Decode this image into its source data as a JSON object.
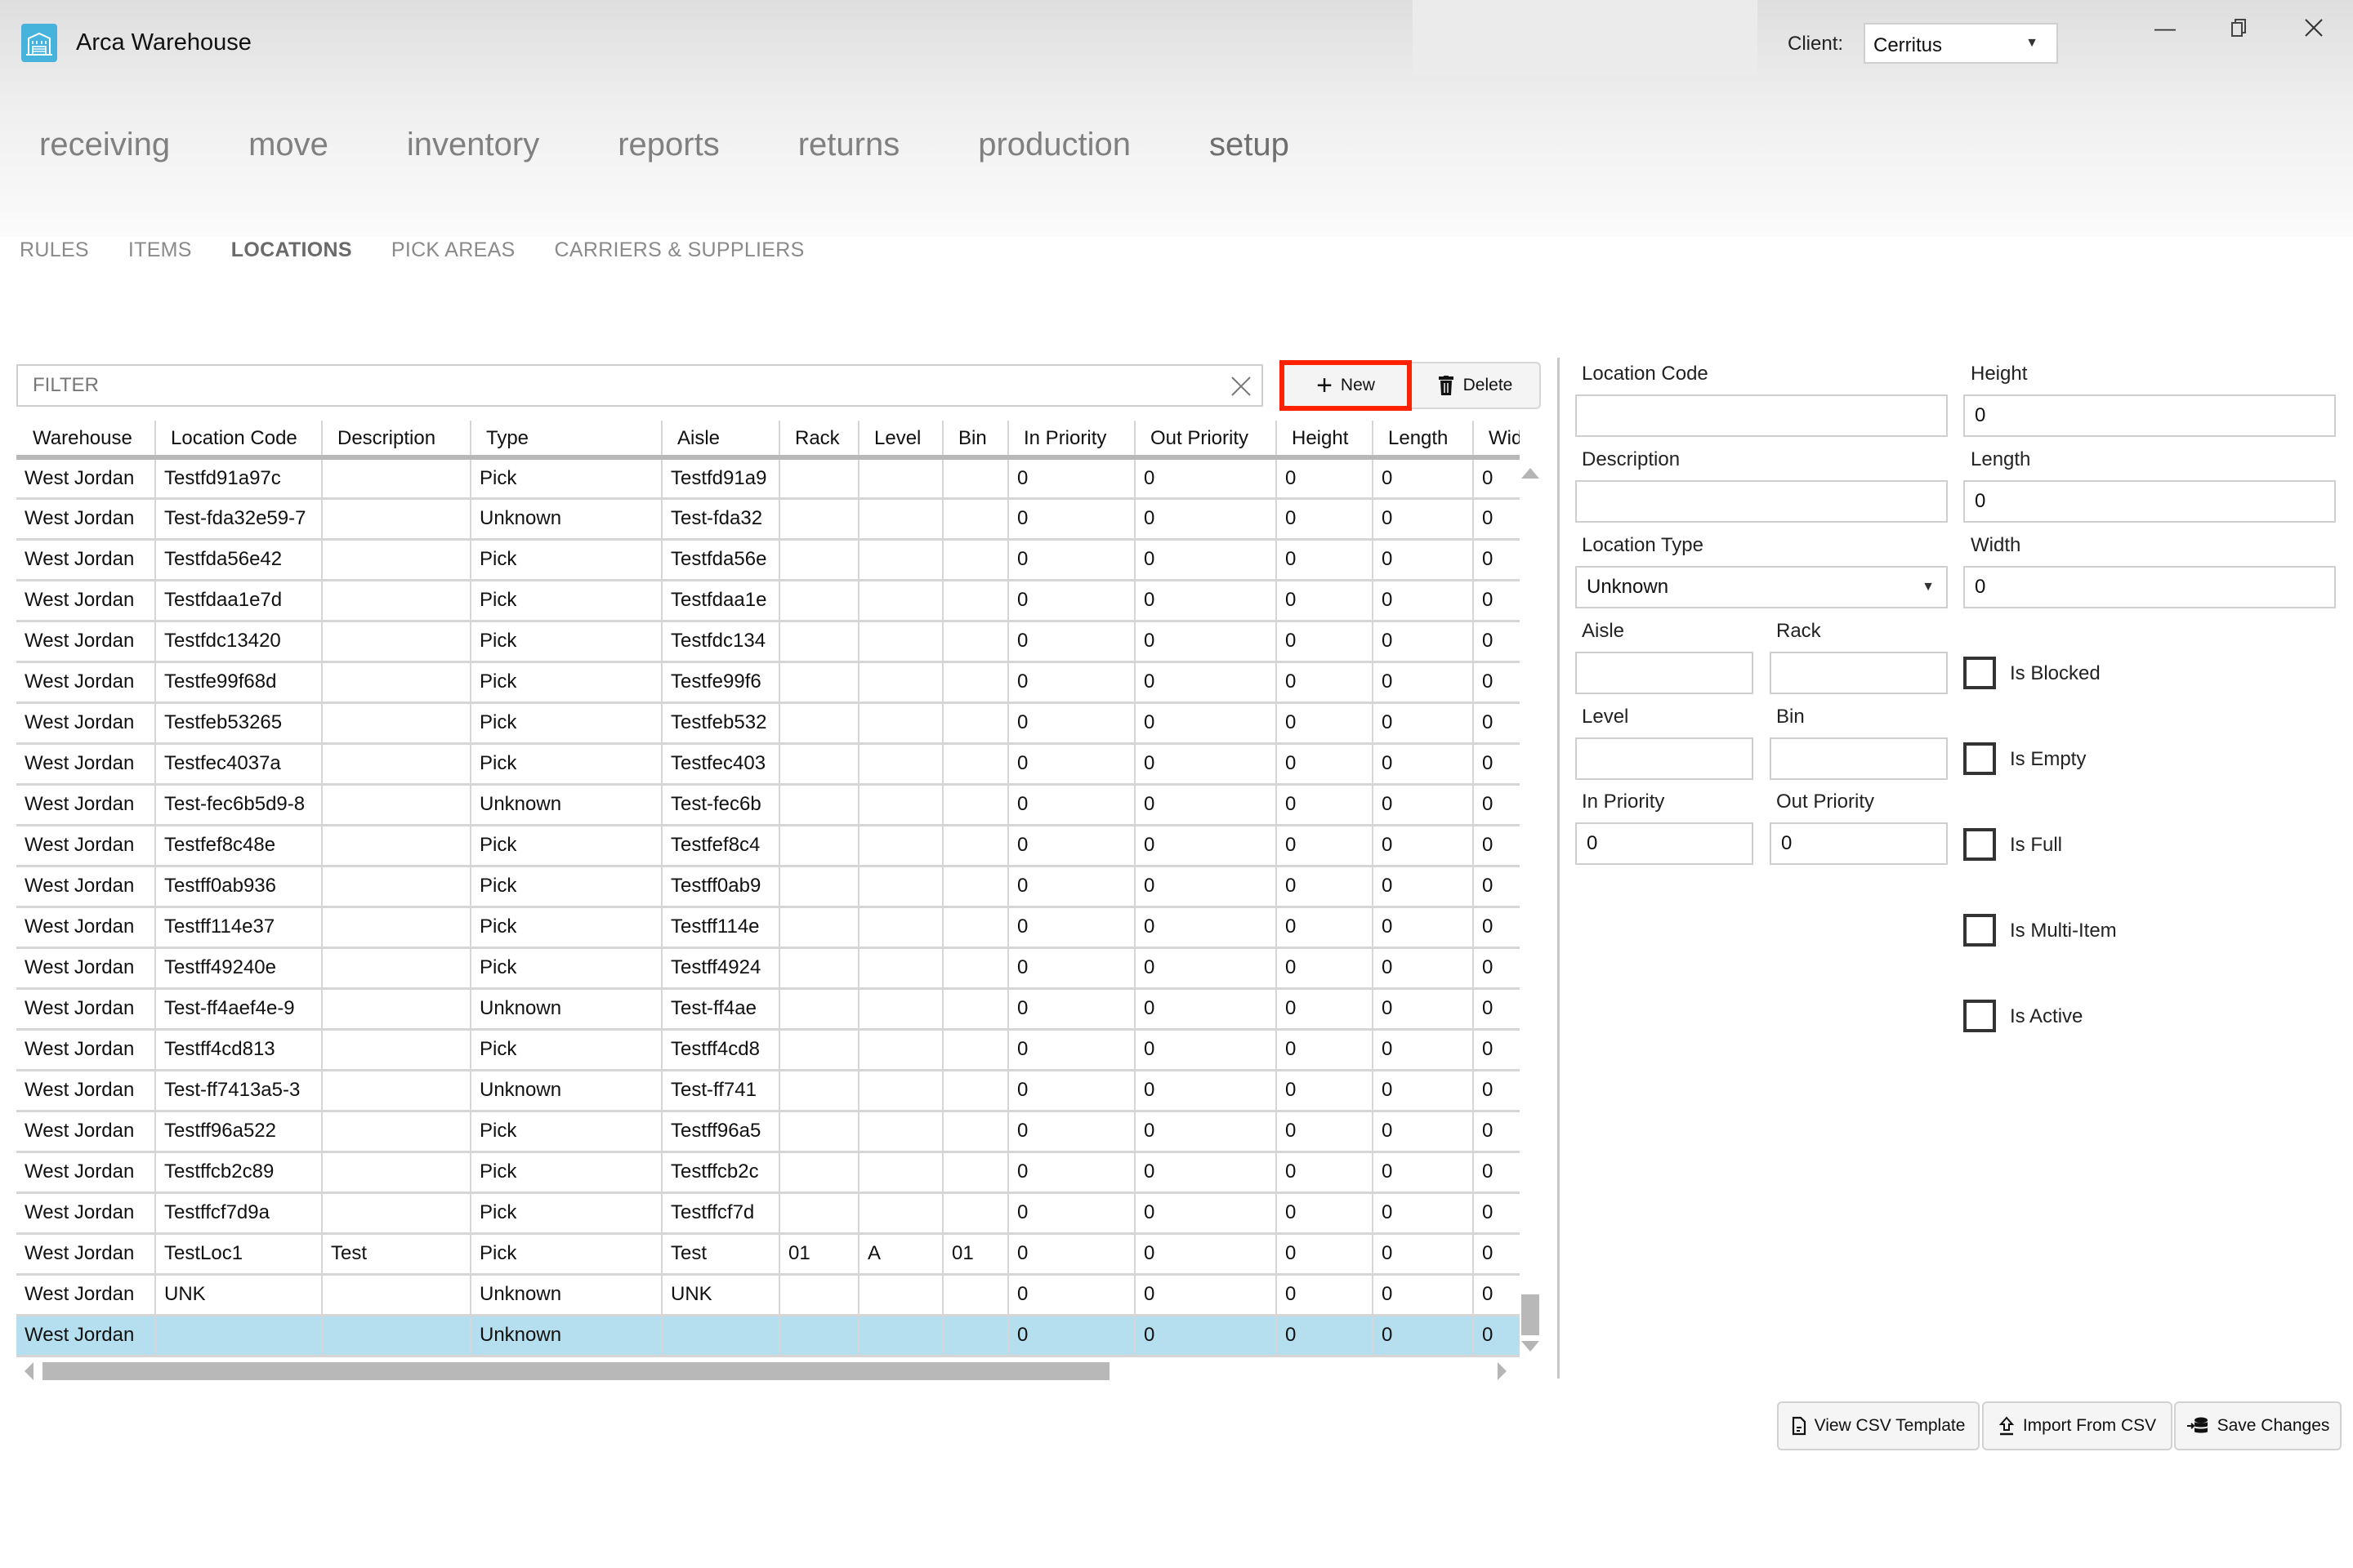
{
  "app": {
    "title": "Arca Warehouse",
    "client_label": "Client:",
    "client_value": "Cerritus",
    "window_controls": {
      "minimize": "minimize-icon",
      "restore": "restore-icon",
      "close": "close-icon"
    }
  },
  "main_nav": [
    {
      "label": "receiving",
      "active": false
    },
    {
      "label": "move",
      "active": false
    },
    {
      "label": "inventory",
      "active": false
    },
    {
      "label": "reports",
      "active": false
    },
    {
      "label": "returns",
      "active": false
    },
    {
      "label": "production",
      "active": false
    },
    {
      "label": "setup",
      "active": true
    }
  ],
  "sub_nav": [
    {
      "label": "RULES",
      "active": false
    },
    {
      "label": "ITEMS",
      "active": false
    },
    {
      "label": "LOCATIONS",
      "active": true
    },
    {
      "label": "PICK AREAS",
      "active": false
    },
    {
      "label": "CARRIERS & SUPPLIERS",
      "active": false
    }
  ],
  "toolbar": {
    "filter_placeholder": "FILTER",
    "filter_value": "",
    "new_label": "New",
    "delete_label": "Delete",
    "highlight_color": "#ff2200"
  },
  "grid": {
    "columns": [
      "Warehouse",
      "Location Code",
      "Description",
      "Type",
      "Aisle",
      "Rack",
      "Level",
      "Bin",
      "In Priority",
      "Out Priority",
      "Height",
      "Length",
      "Wid"
    ],
    "selected_row_color": "#b5dfee",
    "rows": [
      [
        "West Jordan",
        "Testfd91a97c",
        "",
        "Pick",
        "Testfd91a9",
        "",
        "",
        "",
        "0",
        "0",
        "0",
        "0",
        "0"
      ],
      [
        "West Jordan",
        "Test-fda32e59-7",
        "",
        "Unknown",
        "Test-fda32",
        "",
        "",
        "",
        "0",
        "0",
        "0",
        "0",
        "0"
      ],
      [
        "West Jordan",
        "Testfda56e42",
        "",
        "Pick",
        "Testfda56e",
        "",
        "",
        "",
        "0",
        "0",
        "0",
        "0",
        "0"
      ],
      [
        "West Jordan",
        "Testfdaa1e7d",
        "",
        "Pick",
        "Testfdaa1e",
        "",
        "",
        "",
        "0",
        "0",
        "0",
        "0",
        "0"
      ],
      [
        "West Jordan",
        "Testfdc13420",
        "",
        "Pick",
        "Testfdc134",
        "",
        "",
        "",
        "0",
        "0",
        "0",
        "0",
        "0"
      ],
      [
        "West Jordan",
        "Testfe99f68d",
        "",
        "Pick",
        "Testfe99f6",
        "",
        "",
        "",
        "0",
        "0",
        "0",
        "0",
        "0"
      ],
      [
        "West Jordan",
        "Testfeb53265",
        "",
        "Pick",
        "Testfeb532",
        "",
        "",
        "",
        "0",
        "0",
        "0",
        "0",
        "0"
      ],
      [
        "West Jordan",
        "Testfec4037a",
        "",
        "Pick",
        "Testfec403",
        "",
        "",
        "",
        "0",
        "0",
        "0",
        "0",
        "0"
      ],
      [
        "West Jordan",
        "Test-fec6b5d9-8",
        "",
        "Unknown",
        "Test-fec6b",
        "",
        "",
        "",
        "0",
        "0",
        "0",
        "0",
        "0"
      ],
      [
        "West Jordan",
        "Testfef8c48e",
        "",
        "Pick",
        "Testfef8c4",
        "",
        "",
        "",
        "0",
        "0",
        "0",
        "0",
        "0"
      ],
      [
        "West Jordan",
        "Testff0ab936",
        "",
        "Pick",
        "Testff0ab9",
        "",
        "",
        "",
        "0",
        "0",
        "0",
        "0",
        "0"
      ],
      [
        "West Jordan",
        "Testff114e37",
        "",
        "Pick",
        "Testff114e",
        "",
        "",
        "",
        "0",
        "0",
        "0",
        "0",
        "0"
      ],
      [
        "West Jordan",
        "Testff49240e",
        "",
        "Pick",
        "Testff4924",
        "",
        "",
        "",
        "0",
        "0",
        "0",
        "0",
        "0"
      ],
      [
        "West Jordan",
        "Test-ff4aef4e-9",
        "",
        "Unknown",
        "Test-ff4ae",
        "",
        "",
        "",
        "0",
        "0",
        "0",
        "0",
        "0"
      ],
      [
        "West Jordan",
        "Testff4cd813",
        "",
        "Pick",
        "Testff4cd8",
        "",
        "",
        "",
        "0",
        "0",
        "0",
        "0",
        "0"
      ],
      [
        "West Jordan",
        "Test-ff7413a5-3",
        "",
        "Unknown",
        "Test-ff741",
        "",
        "",
        "",
        "0",
        "0",
        "0",
        "0",
        "0"
      ],
      [
        "West Jordan",
        "Testff96a522",
        "",
        "Pick",
        "Testff96a5",
        "",
        "",
        "",
        "0",
        "0",
        "0",
        "0",
        "0"
      ],
      [
        "West Jordan",
        "Testffcb2c89",
        "",
        "Pick",
        "Testffcb2c",
        "",
        "",
        "",
        "0",
        "0",
        "0",
        "0",
        "0"
      ],
      [
        "West Jordan",
        "Testffcf7d9a",
        "",
        "Pick",
        "Testffcf7d",
        "",
        "",
        "",
        "0",
        "0",
        "0",
        "0",
        "0"
      ],
      [
        "West Jordan",
        "TestLoc1",
        "Test",
        "Pick",
        "Test",
        "01",
        "A",
        "01",
        "0",
        "0",
        "0",
        "0",
        "0"
      ],
      [
        "West Jordan",
        "UNK",
        "",
        "Unknown",
        "UNK",
        "",
        "",
        "",
        "0",
        "0",
        "0",
        "0",
        "0"
      ],
      [
        "West Jordan",
        "",
        "",
        "Unknown",
        "",
        "",
        "",
        "",
        "0",
        "0",
        "0",
        "0",
        "0"
      ]
    ],
    "selected_row_index": 21
  },
  "form": {
    "location_code": {
      "label": "Location Code",
      "value": ""
    },
    "description": {
      "label": "Description",
      "value": ""
    },
    "location_type": {
      "label": "Location Type",
      "value": "Unknown"
    },
    "height": {
      "label": "Height",
      "value": "0"
    },
    "length": {
      "label": "Length",
      "value": "0"
    },
    "width": {
      "label": "Width",
      "value": "0"
    },
    "aisle": {
      "label": "Aisle",
      "value": ""
    },
    "rack": {
      "label": "Rack",
      "value": ""
    },
    "level": {
      "label": "Level",
      "value": ""
    },
    "bin": {
      "label": "Bin",
      "value": ""
    },
    "in_priority": {
      "label": "In Priority",
      "value": "0"
    },
    "out_priority": {
      "label": "Out Priority",
      "value": "0"
    },
    "checkboxes": [
      {
        "label": "Is Blocked",
        "checked": false
      },
      {
        "label": "Is Empty",
        "checked": false
      },
      {
        "label": "Is Full",
        "checked": false
      },
      {
        "label": "Is Multi-Item",
        "checked": false
      },
      {
        "label": "Is Active",
        "checked": false
      }
    ]
  },
  "actions": {
    "view_csv_template": "View CSV Template",
    "import_from_csv": "Import From CSV",
    "save_changes": "Save Changes"
  }
}
